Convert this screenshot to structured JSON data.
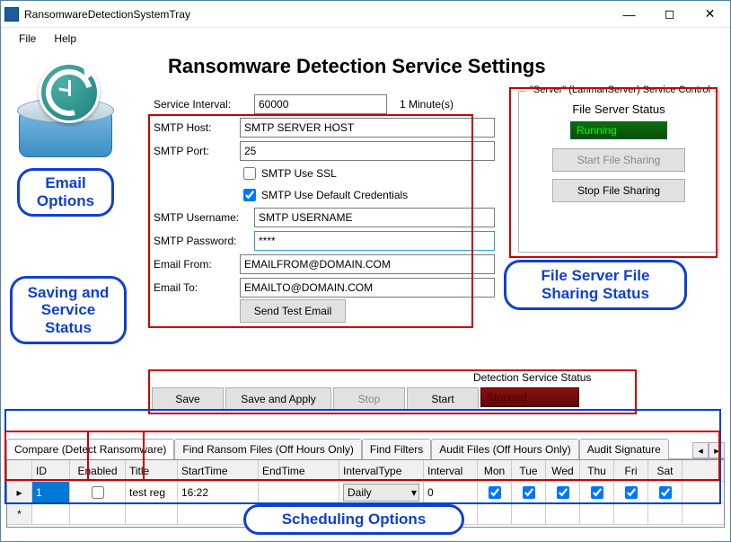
{
  "window": {
    "title": "RansomwareDetectionSystemTray"
  },
  "menu": {
    "file": "File",
    "help": "Help"
  },
  "heading": "Ransomware Detection Service Settings",
  "form": {
    "interval_label": "Service Interval:",
    "interval_value": "60000",
    "interval_unit": "1 Minute(s)",
    "smtp_host_label": "SMTP Host:",
    "smtp_host_value": "SMTP SERVER HOST",
    "smtp_port_label": "SMTP Port:",
    "smtp_port_value": "25",
    "use_ssl_label": "SMTP Use SSL",
    "use_default_creds_label": "SMTP Use Default Credentials",
    "username_label": "SMTP Username:",
    "username_value": "SMTP USERNAME",
    "password_label": "SMTP Password:",
    "password_value": "****",
    "from_label": "Email From:",
    "from_value": "EMAILFROM@DOMAIN.COM",
    "to_label": "Email To:",
    "to_value": "EMAILTO@DOMAIN.COM",
    "send_test_label": "Send Test Email"
  },
  "server": {
    "legend": "\"Server\" (LanmanServer) Service Control",
    "heading": "File Server Status",
    "status": "Running",
    "start_label": "Start File Sharing",
    "stop_label": "Stop File Sharing"
  },
  "actions": {
    "save": "Save",
    "save_apply": "Save and Apply",
    "stop": "Stop",
    "start": "Start",
    "status_label": "Detection Service Status",
    "status_value": "Stopped"
  },
  "tabs": {
    "compare": "Compare (Detect Ransomware)",
    "find_ransom": "Find Ransom Files (Off Hours Only)",
    "find_filters": "Find Filters",
    "audit_files": "Audit Files (Off Hours Only)",
    "audit_sig": "Audit Signature"
  },
  "grid": {
    "h_id": "ID",
    "h_enabled": "Enabled",
    "h_title": "Title",
    "h_start": "StartTime",
    "h_end": "EndTime",
    "h_itype": "IntervalType",
    "h_int": "Interval",
    "h_mon": "Mon",
    "h_tue": "Tue",
    "h_wed": "Wed",
    "h_thu": "Thu",
    "h_fri": "Fri",
    "h_sat": "Sat",
    "r1_id": "1",
    "r1_title": "test reg",
    "r1_start": "16:22",
    "r1_itype": "Daily",
    "r1_int": "0"
  },
  "callouts": {
    "email": "Email Options",
    "saving": "Saving and Service Status",
    "server": "File Server File Sharing Status",
    "sched": "Scheduling Options"
  }
}
